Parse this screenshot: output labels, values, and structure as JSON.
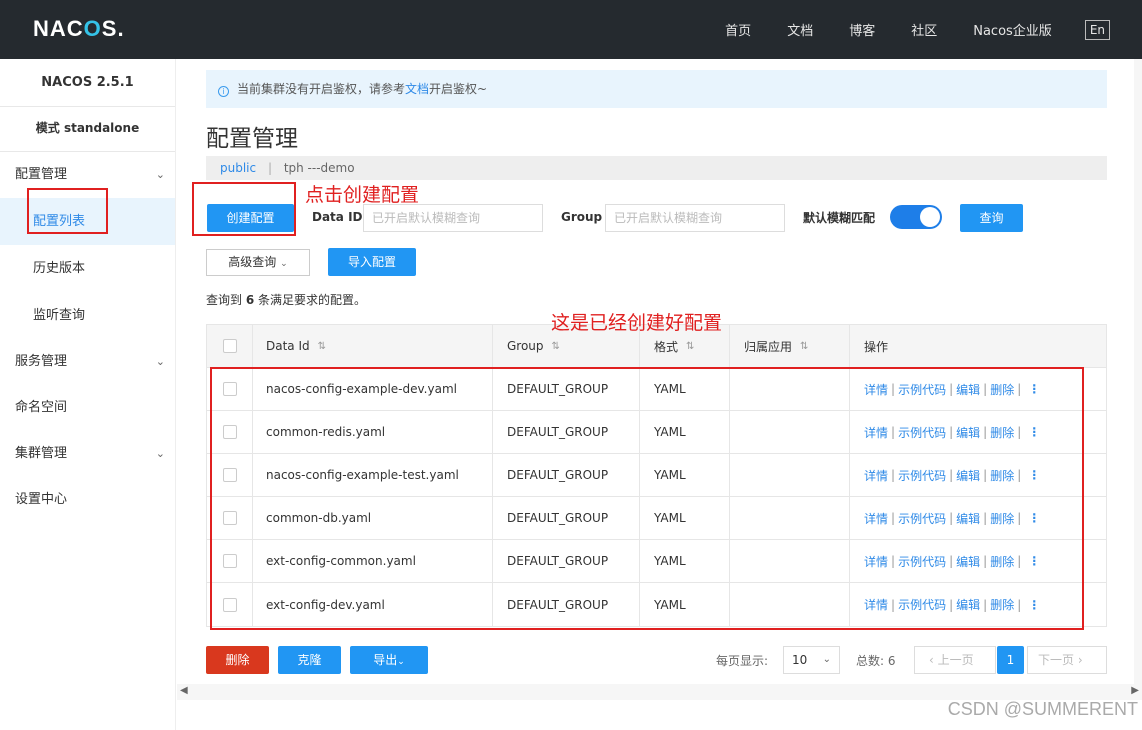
{
  "header": {
    "logo": "NACOS.",
    "nav": [
      "首页",
      "文档",
      "博客",
      "社区",
      "Nacos企业版"
    ],
    "lang": "En"
  },
  "sidebar": {
    "version": "NACOS 2.5.1",
    "mode": "模式 standalone",
    "groups": [
      {
        "label": "配置管理",
        "items": [
          "配置列表",
          "历史版本",
          "监听查询"
        ]
      },
      {
        "label": "服务管理"
      },
      {
        "label": "命名空间"
      },
      {
        "label": "集群管理"
      },
      {
        "label": "设置中心"
      }
    ]
  },
  "notice": {
    "before": "当前集群没有开启鉴权，请参考",
    "link": "文档",
    "after": "开启鉴权~"
  },
  "page_title": "配置管理",
  "namespace": {
    "public": "public",
    "sep": "|",
    "current": "tph ---demo"
  },
  "toolbar": {
    "create": "创建配置",
    "dataid_label": "Data ID",
    "dataid_placeholder": "已开启默认模糊查询",
    "group_label": "Group",
    "group_placeholder": "已开启默认模糊查询",
    "fuzzy_label": "默认模糊匹配",
    "query": "查询",
    "advanced": "高级查询",
    "import": "导入配置"
  },
  "result": {
    "prefix": "查询到",
    "count": "6",
    "suffix": "条满足要求的配置。"
  },
  "table": {
    "headers": [
      "Data Id",
      "Group",
      "格式",
      "归属应用",
      "操作"
    ],
    "rows": [
      {
        "dataid": "nacos-config-example-dev.yaml",
        "group": "DEFAULT_GROUP",
        "format": "YAML",
        "app": ""
      },
      {
        "dataid": "common-redis.yaml",
        "group": "DEFAULT_GROUP",
        "format": "YAML",
        "app": ""
      },
      {
        "dataid": "nacos-config-example-test.yaml",
        "group": "DEFAULT_GROUP",
        "format": "YAML",
        "app": ""
      },
      {
        "dataid": "common-db.yaml",
        "group": "DEFAULT_GROUP",
        "format": "YAML",
        "app": ""
      },
      {
        "dataid": "ext-config-common.yaml",
        "group": "DEFAULT_GROUP",
        "format": "YAML",
        "app": ""
      },
      {
        "dataid": "ext-config-dev.yaml",
        "group": "DEFAULT_GROUP",
        "format": "YAML",
        "app": ""
      }
    ],
    "ops": {
      "detail": "详情",
      "sample": "示例代码",
      "edit": "编辑",
      "delete": "删除",
      "sep": "|"
    }
  },
  "footer": {
    "delete": "删除",
    "clone": "克隆",
    "export": "导出",
    "per_page_label": "每页显示:",
    "per_page": "10",
    "total_label": "总数: 6",
    "prev": "上一页",
    "page": "1",
    "next": "下一页"
  },
  "annotations": {
    "create": "点击创建配置",
    "existing": "这是已经创建好配置"
  },
  "watermark": "CSDN @SUMMERENT",
  "colors": {
    "topbar": "#252a2f",
    "primary": "#2196f3",
    "danger": "#d9381e",
    "annotation": "#e02020"
  }
}
